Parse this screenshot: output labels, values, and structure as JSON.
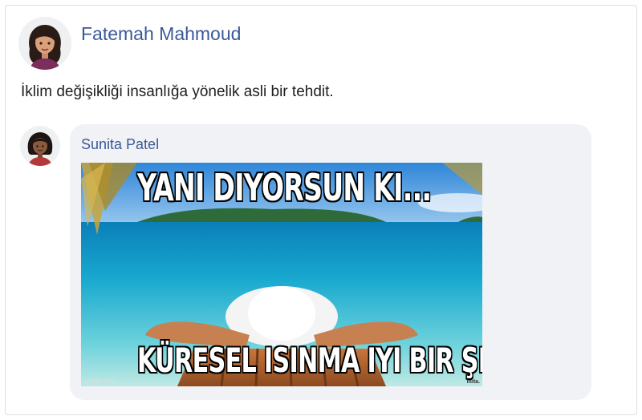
{
  "post": {
    "author": "Fatemah Mahmoud",
    "text": "İklim değişikliği insanlığa yönelik asli bir tehdit."
  },
  "comment": {
    "author": "Sunita Patel",
    "meme": {
      "top_text": "YANI DIYORSUN KI...",
      "bottom_text": "KÜRESEL ISINMA IYI BIR ŞEY DEĞIL",
      "watermark": "imgflip.com",
      "corner_mark": "mita."
    }
  },
  "colors": {
    "author_link": "#3b5998",
    "bubble_bg": "#f0f2f5",
    "card_border": "#dcdde1"
  }
}
